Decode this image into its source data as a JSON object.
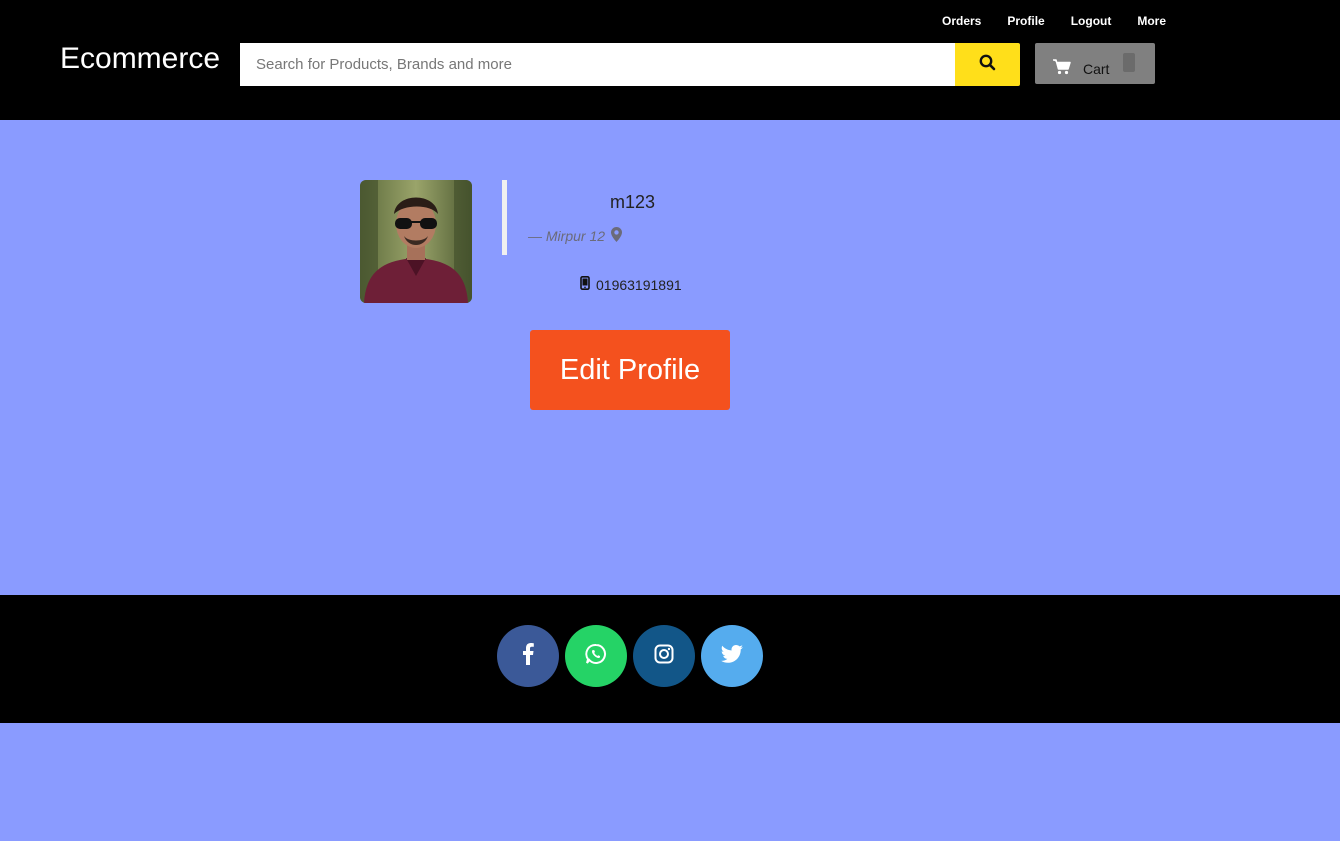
{
  "header": {
    "brand": "Ecommerce",
    "nav": [
      "Orders",
      "Profile",
      "Logout",
      "More"
    ],
    "search": {
      "placeholder": "Search for Products, Brands and more",
      "value": ""
    },
    "cart_label": "Cart",
    "colors": {
      "bar": "#000000",
      "search_button": "#ffdf1a",
      "cart": "#808080"
    }
  },
  "profile": {
    "username": "m123",
    "location": "— Mirpur 12",
    "phone": "01963191891",
    "edit_label": "Edit Profile",
    "edit_color": "#f4511e"
  },
  "footer": {
    "social": [
      {
        "icon": "facebook-icon",
        "color": "#3b5998"
      },
      {
        "icon": "whatsapp-icon",
        "color": "#25d366"
      },
      {
        "icon": "instagram-icon",
        "color": "#125688"
      },
      {
        "icon": "twitter-icon",
        "color": "#55acee"
      }
    ]
  },
  "background": "#8a9bff"
}
